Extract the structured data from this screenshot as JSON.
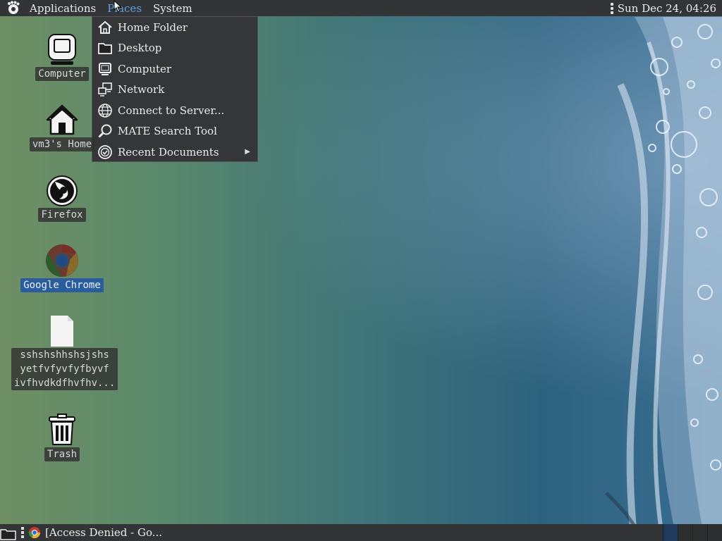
{
  "top_panel": {
    "menus": [
      "Applications",
      "Places",
      "System"
    ],
    "clock": "Sun Dec 24, 04:26",
    "active_menu": "Places",
    "active_color": "#5da0e6"
  },
  "places_menu": {
    "items": [
      {
        "label": "Home Folder",
        "icon": "home-icon"
      },
      {
        "label": "Desktop",
        "icon": "folder-icon"
      },
      {
        "label": "Computer",
        "icon": "computer-icon"
      },
      {
        "label": "Network",
        "icon": "network-icon"
      },
      {
        "label": "Connect to Server...",
        "icon": "globe-icon"
      },
      {
        "label": "MATE Search Tool",
        "icon": "search-icon"
      },
      {
        "label": "Recent Documents",
        "icon": "recent-icon",
        "submenu": true
      }
    ]
  },
  "desktop_icons": [
    {
      "label": "Computer",
      "icon": "computer-icon"
    },
    {
      "label": "vm3's Home",
      "icon": "home-icon"
    },
    {
      "label": "Firefox",
      "icon": "firefox-icon"
    },
    {
      "label": "Google Chrome",
      "icon": "chrome-icon",
      "selected": true
    },
    {
      "label": "sshshshhshsjshs\nyetfvfyvfyfbyvf\nivfhvdkdfhvfhv...",
      "icon": "text-file-icon"
    },
    {
      "label": "Trash",
      "icon": "trash-icon"
    }
  ],
  "bottom_panel": {
    "taskbar_item": "[Access Denied - Go..."
  }
}
